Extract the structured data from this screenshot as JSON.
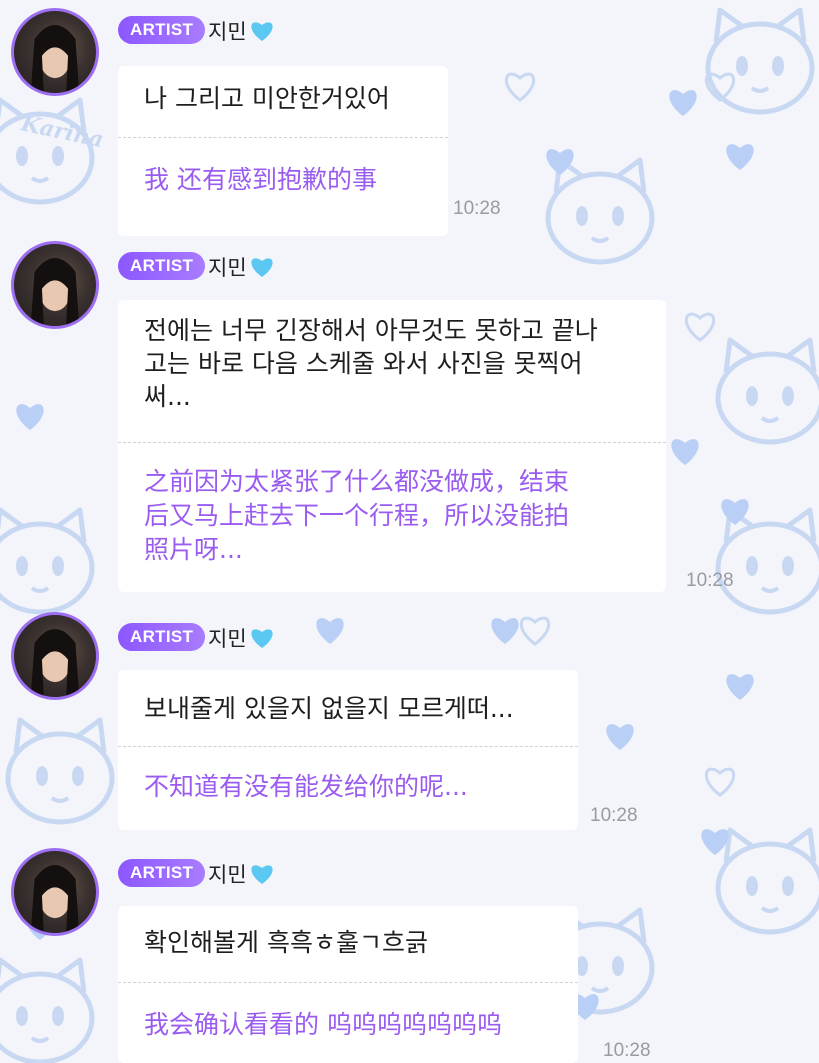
{
  "messages": [
    {
      "badge": "ARTIST",
      "sender": "지민",
      "original": "나 그리고 미안한거있어",
      "translation": "我 还有感到抱歉的事",
      "time": "10:28"
    },
    {
      "badge": "ARTIST",
      "sender": "지민",
      "original": "전에는 너무 긴장해서 아무것도 못하고 끝나\n고는 바로 다음 스케줄 와서 사진을 못찍어\n써...",
      "translation": "之前因为太紧张了什么都没做成，结束\n后又马上赶去下一个行程，所以没能拍\n照片呀...",
      "time": "10:28"
    },
    {
      "badge": "ARTIST",
      "sender": "지민",
      "original": "보내줄게 있을지 없을지 모르게떠...",
      "translation": "不知道有没有能发给你的呢...",
      "time": "10:28"
    },
    {
      "badge": "ARTIST",
      "sender": "지민",
      "original": "확인해볼게 흑흑ㅎ훌ㄱ흐긁",
      "translation": "我会确认看看的 呜呜呜呜呜呜呜",
      "time": "10:28"
    }
  ],
  "wallpaper": {
    "text": "Karina"
  },
  "icons": {
    "name_suffix": "heart-icon",
    "accent": "#9d6ef0",
    "heart_color": "#5bc8f2"
  }
}
